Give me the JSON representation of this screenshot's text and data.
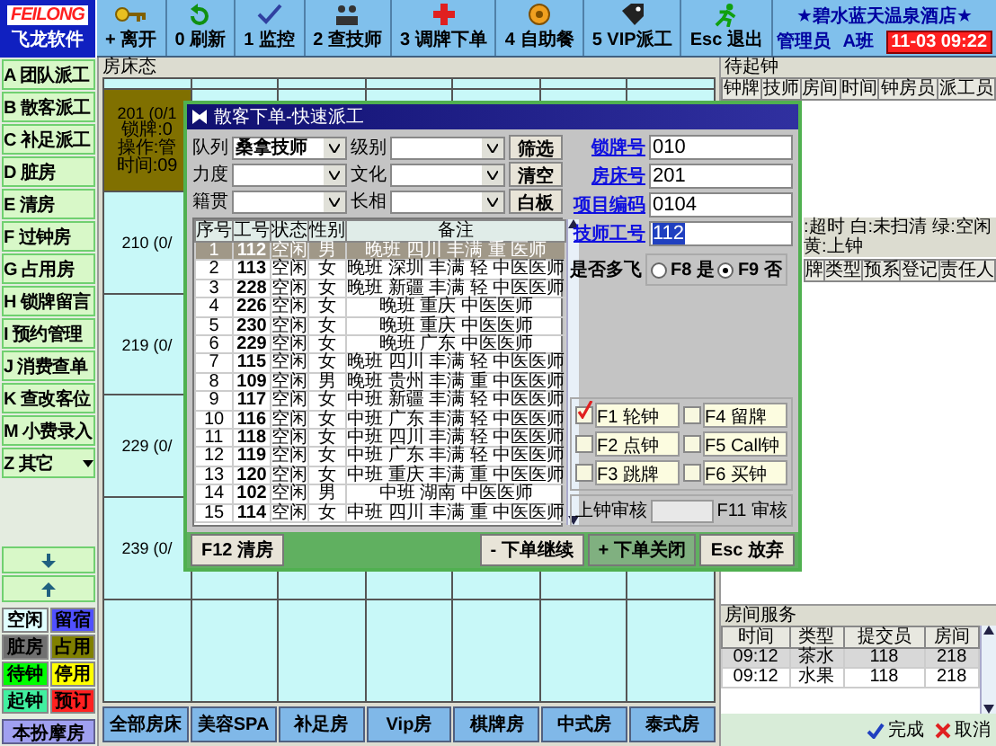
{
  "logo": {
    "brand": "FEILONG",
    "name": "飞龙软件"
  },
  "toolbar": [
    {
      "label": "+ 离开"
    },
    {
      "label": "0 刷新"
    },
    {
      "label": "1 监控"
    },
    {
      "label": "2 查技师"
    },
    {
      "label": "3 调牌下单"
    },
    {
      "label": "4 自助餐"
    },
    {
      "label": "5 VIP派工"
    },
    {
      "label": "Esc 退出"
    }
  ],
  "header": {
    "hotel": "★碧水蓝天温泉酒店★",
    "operator": "管理员",
    "shift": "A班",
    "clock": "11-03 09:22"
  },
  "sidebar": {
    "items": [
      {
        "label": "A 团队派工",
        "kind": "button"
      },
      {
        "label": "B 散客派工",
        "kind": "button"
      },
      {
        "label": "C 补足派工",
        "kind": "button"
      },
      {
        "label": "D 脏房",
        "kind": "button"
      },
      {
        "label": "E 清房",
        "kind": "button"
      },
      {
        "label": "F 过钟房",
        "kind": "button"
      },
      {
        "label": "G 占用房",
        "kind": "button"
      },
      {
        "label": "H 锁牌留言",
        "kind": "button"
      },
      {
        "label": "I 预约管理",
        "kind": "button"
      },
      {
        "label": "J 消费查单",
        "kind": "button"
      },
      {
        "label": "K 查改客位",
        "kind": "button"
      },
      {
        "label": "M 小费录入",
        "kind": "button"
      },
      {
        "label": "Z 其它",
        "kind": "menu"
      }
    ],
    "legend": [
      {
        "label": "空闲",
        "color": "#e0ffff"
      },
      {
        "label": "留宿",
        "color": "#5050ff"
      },
      {
        "label": "脏房",
        "color": "#707070"
      },
      {
        "label": "占用",
        "color": "#808000"
      },
      {
        "label": "待钟",
        "color": "#00ff00"
      },
      {
        "label": "停用",
        "color": "#ffff00"
      },
      {
        "label": "起钟",
        "color": "#40f0a0"
      },
      {
        "label": "预订",
        "color": "#ff2020"
      }
    ],
    "footer_button": "本扮摩房"
  },
  "rooms": {
    "title": "房床态",
    "cards": [
      {
        "lines": [
          "201 (0/1",
          "锁牌:0",
          "操作:管",
          "时间:09"
        ],
        "color": "#807000"
      },
      {
        "lines": [
          "210 (0/"
        ],
        "color": "#c8f8f8"
      },
      {
        "lines": [
          "219 (0/"
        ],
        "color": "#c8f8f8"
      },
      {
        "lines": [
          "229 (0/"
        ],
        "color": "#c8f8f8"
      },
      {
        "lines": [
          "239 (0/"
        ],
        "color": "#c8f8f8"
      }
    ],
    "tabs": [
      "全部房床",
      "美容SPA",
      "补足房",
      "Vip房",
      "棋牌房",
      "中式房",
      "泰式房"
    ]
  },
  "waiting": {
    "title": "待起钟",
    "columns": [
      "钟牌",
      "技师",
      "房间",
      "时间",
      "钟房员",
      "派工员"
    ],
    "legend": [
      ":超时",
      "白:未扫清",
      "绿:空闲",
      "黄:上钟"
    ],
    "columns_2": [
      "牌",
      "类型",
      "预系",
      "登记",
      "责任人"
    ]
  },
  "room_service": {
    "title": "房间服务",
    "columns": [
      "时间",
      "类型",
      "提交员",
      "房间"
    ],
    "rows": [
      {
        "cells": [
          "09:12",
          "茶水",
          "118",
          "218"
        ],
        "selected": true
      },
      {
        "cells": [
          "09:12",
          "水果",
          "118",
          "218"
        ],
        "selected": false
      }
    ],
    "buttons": [
      {
        "label": "完成",
        "kind": "ok"
      },
      {
        "label": "取消",
        "kind": "cancel"
      }
    ]
  },
  "dialog": {
    "title": "散客下单-快速派工",
    "filters": [
      {
        "label": "队列",
        "value": "桑拿技师"
      },
      {
        "label": "级别"
      },
      {
        "label": "筛选",
        "kind": "button"
      },
      {
        "label": "力度"
      },
      {
        "label": "文化"
      },
      {
        "label": "清空",
        "kind": "button"
      },
      {
        "label": "籍贯"
      },
      {
        "label": "长相"
      },
      {
        "label": "白板",
        "kind": "button"
      }
    ],
    "table": {
      "columns": [
        "序号",
        "工号",
        "状态",
        "性别",
        "备注"
      ],
      "rows": [
        {
          "cells": [
            "1",
            "112",
            "空闲",
            "男",
            "晚班 四川 丰满 重 医师"
          ],
          "selected": true
        },
        {
          "cells": [
            "2",
            "113",
            "空闲",
            "女",
            "晚班 深圳 丰满 轻 中医医师"
          ],
          "selected": false
        },
        {
          "cells": [
            "3",
            "228",
            "空闲",
            "女",
            "晚班 新疆 丰满 轻 中医医师"
          ],
          "selected": false
        },
        {
          "cells": [
            "4",
            "226",
            "空闲",
            "女",
            "晚班 重庆 中医医师"
          ],
          "selected": false
        },
        {
          "cells": [
            "5",
            "230",
            "空闲",
            "女",
            "晚班 重庆 中医医师"
          ],
          "selected": false
        },
        {
          "cells": [
            "6",
            "229",
            "空闲",
            "女",
            "晚班 广东 中医医师"
          ],
          "selected": false
        },
        {
          "cells": [
            "7",
            "115",
            "空闲",
            "女",
            "晚班 四川 丰满 轻 中医医师"
          ],
          "selected": false
        },
        {
          "cells": [
            "8",
            "109",
            "空闲",
            "男",
            "晚班 贵州 丰满 重 中医医师"
          ],
          "selected": false
        },
        {
          "cells": [
            "9",
            "117",
            "空闲",
            "女",
            "中班 新疆 丰满 轻 中医医师"
          ],
          "selected": false
        },
        {
          "cells": [
            "10",
            "116",
            "空闲",
            "女",
            "中班 广东 丰满 轻 中医医师"
          ],
          "selected": false
        },
        {
          "cells": [
            "11",
            "118",
            "空闲",
            "女",
            "中班 四川 丰满 轻 中医医师"
          ],
          "selected": false
        },
        {
          "cells": [
            "12",
            "119",
            "空闲",
            "女",
            "中班 广东 丰满 轻 中医医师"
          ],
          "selected": false
        },
        {
          "cells": [
            "13",
            "120",
            "空闲",
            "女",
            "中班 重庆 丰满 重 中医医师"
          ],
          "selected": false
        },
        {
          "cells": [
            "14",
            "102",
            "空闲",
            "男",
            "中班 湖南 中医医师"
          ],
          "selected": false
        },
        {
          "cells": [
            "15",
            "114",
            "空闲",
            "女",
            "中班 四川 丰满 重 中医医师"
          ],
          "selected": false
        }
      ]
    },
    "fields": [
      {
        "label": "锁牌号",
        "value": "010",
        "text_selected": false
      },
      {
        "label": "房床号",
        "value": "201",
        "text_selected": false
      },
      {
        "label": "项目编码",
        "value": "0104",
        "text_selected": false
      },
      {
        "label": "技师工号",
        "value": "112",
        "text_selected": true
      }
    ],
    "multi_fly": {
      "label": "是否多飞",
      "options": [
        {
          "label": "F8 是",
          "selected": false
        },
        {
          "label": "F9 否",
          "selected": true
        }
      ]
    },
    "bell_types": [
      {
        "label": "F1 轮钟",
        "checked": true
      },
      {
        "label": "F4 留牌",
        "checked": false
      },
      {
        "label": "F2 点钟",
        "checked": false
      },
      {
        "label": "F5 Call钟",
        "checked": false
      },
      {
        "label": "F3 跳牌",
        "checked": false
      },
      {
        "label": "F6 买钟",
        "checked": false
      }
    ],
    "review": {
      "label": "上钟审核",
      "button": "F11 审核"
    },
    "buttons": [
      {
        "label": "F12 清房",
        "default": false
      },
      {
        "label": "- 下单继续",
        "default": false
      },
      {
        "label": "+ 下单关闭",
        "default": true
      },
      {
        "label": "Esc 放弃",
        "default": false
      }
    ]
  }
}
